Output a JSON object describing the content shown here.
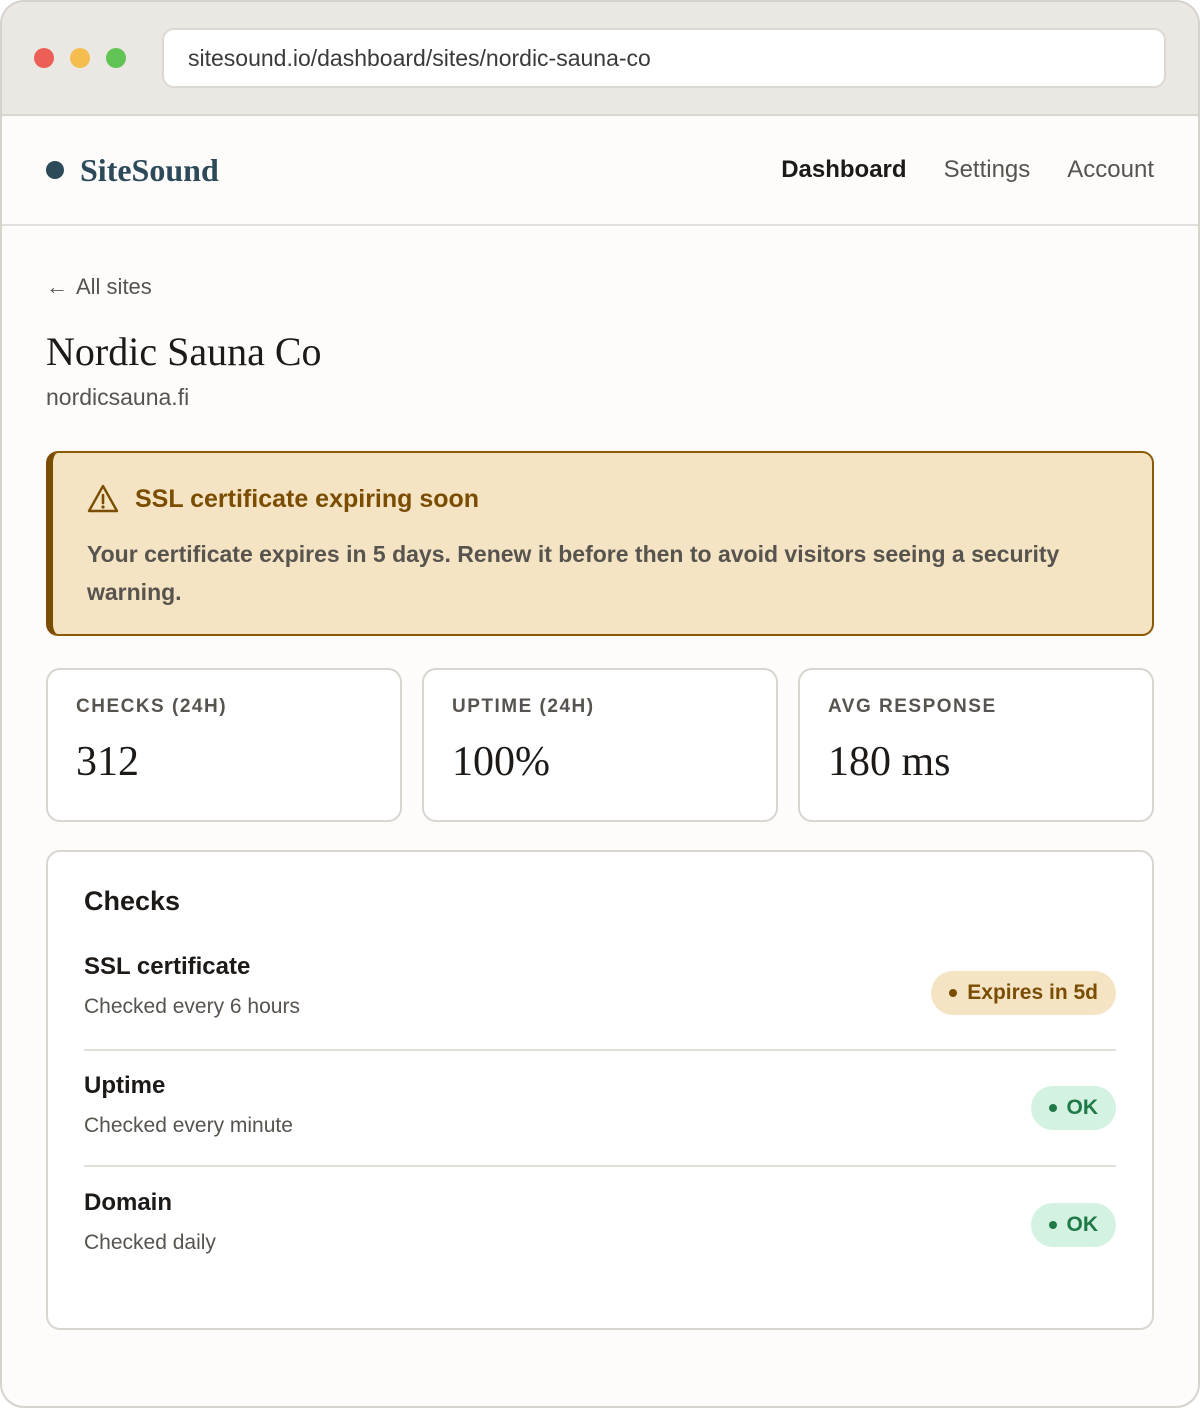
{
  "browser": {
    "url": "sitesound.io/dashboard/sites/nordic-sauna-co",
    "traffic_lights": [
      "#ec5f57",
      "#f5bd4f",
      "#61c454"
    ]
  },
  "header": {
    "brand": "SiteSound",
    "nav": [
      {
        "label": "Dashboard",
        "active": true
      },
      {
        "label": "Settings",
        "active": false
      },
      {
        "label": "Account",
        "active": false
      }
    ]
  },
  "page": {
    "back_arrow": "←",
    "back_label": "All sites",
    "title": "Nordic Sauna Co",
    "domain": "nordicsauna.fi"
  },
  "alert": {
    "icon": "warning-triangle-icon",
    "title": "SSL certificate expiring soon",
    "body": "Your certificate expires in 5 days. Renew it before then to avoid visitors seeing a security warning."
  },
  "stats": [
    {
      "label": "CHECKS (24H)",
      "value": "312"
    },
    {
      "label": "UPTIME (24H)",
      "value": "100%"
    },
    {
      "label": "AVG RESPONSE",
      "value": "180 ms"
    }
  ],
  "checks": {
    "title": "Checks",
    "items": [
      {
        "name": "SSL certificate",
        "frequency": "Checked every 6 hours",
        "status": "Expires in 5d",
        "status_type": "warning"
      },
      {
        "name": "Uptime",
        "frequency": "Checked every minute",
        "status": "OK",
        "status_type": "ok"
      },
      {
        "name": "Domain",
        "frequency": "Checked daily",
        "status": "OK",
        "status_type": "ok"
      }
    ]
  },
  "colors": {
    "brand": "#2c4a5a",
    "warning_bg": "#f5e4c3",
    "warning_text": "#7a4d02",
    "ok_bg": "#d4f2e1",
    "ok_text": "#1f7a47"
  }
}
